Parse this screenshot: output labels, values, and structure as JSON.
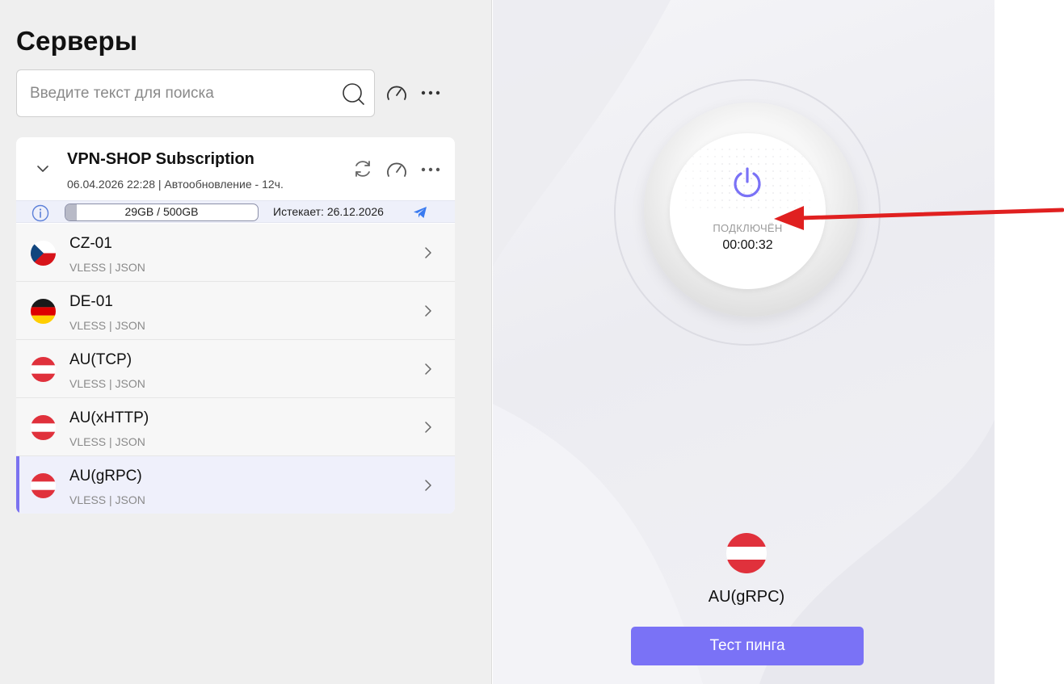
{
  "page": {
    "title": "Серверы"
  },
  "search": {
    "placeholder": "Введите текст для поиска"
  },
  "subscription": {
    "name": "VPN-SHOP Subscription",
    "meta": "06.04.2026 22:28 | Автообновление - 12ч.",
    "usage_text": "29GB / 500GB",
    "usage_used_gb": 29,
    "usage_total_gb": 500,
    "expiry": "Истекает: 26.12.2026"
  },
  "servers": [
    {
      "name": "CZ-01",
      "proto": "VLESS | JSON",
      "flag": "cz-flag-icon",
      "selected": false
    },
    {
      "name": "DE-01",
      "proto": "VLESS | JSON",
      "flag": "de-flag-icon",
      "selected": false
    },
    {
      "name": "AU(TCP)",
      "proto": "VLESS | JSON",
      "flag": "at-flag-icon",
      "selected": false
    },
    {
      "name": "AU(xHTTP)",
      "proto": "VLESS | JSON",
      "flag": "at-flag-icon",
      "selected": false
    },
    {
      "name": "AU(gRPC)",
      "proto": "VLESS | JSON",
      "flag": "at-flag-icon",
      "selected": true
    }
  ],
  "connection": {
    "status": "ПОДКЛЮЧЁН",
    "timer": "00:00:32",
    "current_server": "AU(gRPC)",
    "ping_button": "Тест пинга"
  },
  "colors": {
    "accent": "#7a72f6",
    "selection_bar": "#7b72f0",
    "annotation_arrow": "#e02020",
    "telegram": "#3a7bf0"
  }
}
